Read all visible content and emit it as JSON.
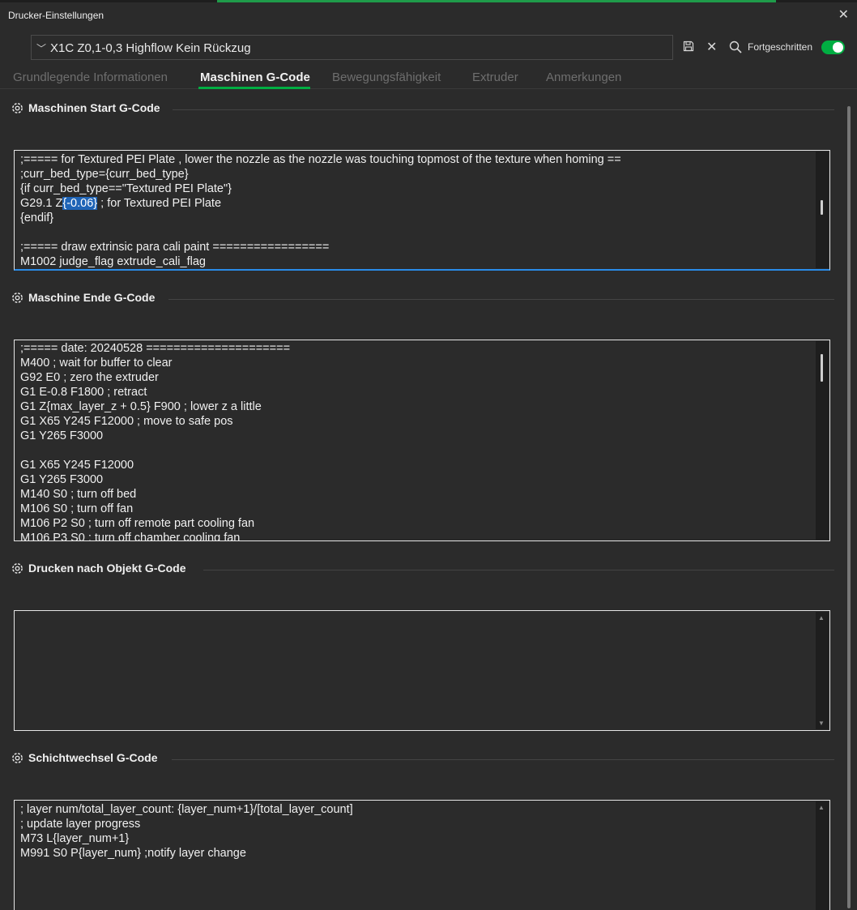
{
  "window": {
    "title": "Drucker-Einstellungen",
    "close_glyph": "✕"
  },
  "preset": {
    "chevron": "﹀",
    "name": "X1C Z0,1-0,3 Highflow Kein Rückzug",
    "save_icon": "floppy-disk-icon",
    "delete_glyph": "✕",
    "search_icon": "magnifier-icon",
    "advanced_label": "Fortgeschritten",
    "advanced_enabled": true
  },
  "tabs": [
    {
      "label": "Grundlegende Informationen",
      "active": false
    },
    {
      "label": "Maschinen G-Code",
      "active": true
    },
    {
      "label": "Bewegungsfähigkeit",
      "active": false
    },
    {
      "label": "Extruder",
      "active": false
    },
    {
      "label": "Anmerkungen",
      "active": false
    }
  ],
  "sections": {
    "start": {
      "title": "Maschinen Start G-Code",
      "lines_before": [
        ";===== for Textured PEI Plate , lower the nozzle as the nozzle was touching topmost of the texture when homing ==",
        ";curr_bed_type={curr_bed_type}",
        "{if curr_bed_type==\"Textured PEI Plate\"}"
      ],
      "sel_prefix": "G29.1 Z",
      "sel_text": "{-0.06}",
      "sel_suffix": " ; for Textured PEI Plate",
      "lines_after": [
        "{endif}",
        "",
        ";===== draw extrinsic para cali paint =================",
        "M1002 judge_flag extrude_cali_flag"
      ]
    },
    "end": {
      "title": "Maschine Ende G-Code",
      "lines": [
        ";===== date: 20240528 =====================",
        "M400 ; wait for buffer to clear",
        "G92 E0 ; zero the extruder",
        "G1 E-0.8 F1800 ; retract",
        "G1 Z{max_layer_z + 0.5} F900 ; lower z a little",
        "G1 X65 Y245 F12000 ; move to safe pos",
        "G1 Y265 F3000",
        "",
        "G1 X65 Y245 F12000",
        "G1 Y265 F3000",
        "M140 S0 ; turn off bed",
        "M106 S0 ; turn off fan",
        "M106 P2 S0 ; turn off remote part cooling fan",
        "M106 P3 S0 ; turn off chamber cooling fan"
      ]
    },
    "after_object": {
      "title": "Drucken nach Objekt G-Code",
      "lines": []
    },
    "layer_change": {
      "title": "Schichtwechsel G-Code",
      "lines": [
        "; layer num/total_layer_count: {layer_num+1}/[total_layer_count]",
        "; update layer progress",
        "M73 L{layer_num+1}",
        "M991 S0 P{layer_num} ;notify layer change"
      ]
    }
  }
}
